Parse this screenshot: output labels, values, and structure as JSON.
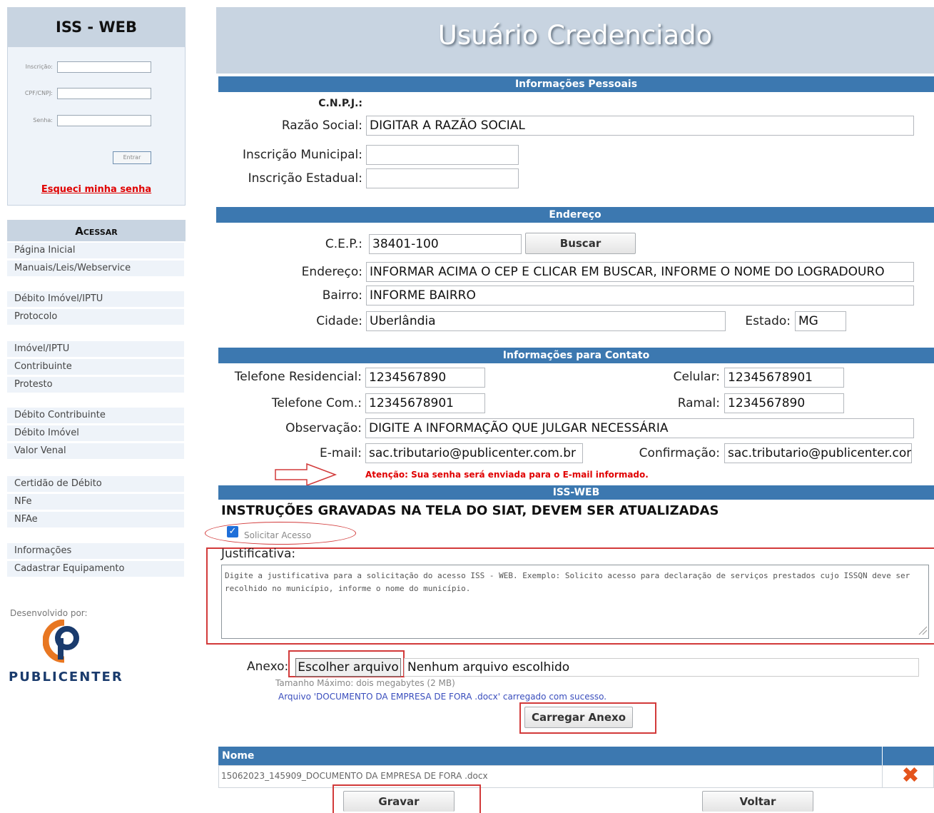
{
  "sidebar": {
    "title": "ISS - WEB",
    "login": {
      "inscricao_label": "Inscrição:",
      "cpf_label": "CPF/CNPJ:",
      "senha_label": "Senha:",
      "enter_label": "Entrar",
      "forgot_label": "Esqueci minha senha"
    },
    "menu_title": "Acessar",
    "menu_items": [
      "Página Inicial",
      "Manuais/Leis/Webservice",
      "Débito Imóvel/IPTU",
      "Protocolo",
      "Imóvel/IPTU",
      "Contribuinte",
      "Protesto",
      "Débito Contribuinte",
      "Débito Imóvel",
      "Valor Venal",
      "Certidão de Débito",
      "NFe",
      "NFAe",
      "Informações",
      "Cadastrar Equipamento"
    ],
    "developed_by": "Desenvolvido por:",
    "logo_text": "PUBLICENTER"
  },
  "main": {
    "title": "Usuário Credenciado",
    "sections": {
      "personal": "Informações Pessoais",
      "address": "Endereço",
      "contact": "Informações para Contato",
      "iss": "ISS-WEB"
    },
    "personal": {
      "cnpj_label": "C.N.P.J.:",
      "razao_label": "Razão Social:",
      "razao_value": "DIGITAR A RAZÃO SOCIAL",
      "insc_mun_label": "Inscrição Municipal:",
      "insc_mun_value": "",
      "insc_est_label": "Inscrição Estadual:",
      "insc_est_value": ""
    },
    "address": {
      "cep_label": "C.E.P.:",
      "cep_value": "38401-100",
      "buscar_label": "Buscar",
      "endereco_label": "Endereço:",
      "endereco_value": "INFORMAR ACIMA O CEP E CLICAR EM BUSCAR, INFORME O NOME DO LOGRADOURO",
      "bairro_label": "Bairro:",
      "bairro_value": "INFORME BAIRRO",
      "cidade_label": "Cidade:",
      "cidade_value": "Uberlândia",
      "estado_label": "Estado:",
      "estado_value": "MG"
    },
    "contact": {
      "tel_res_label": "Telefone Residencial:",
      "tel_res_value": "1234567890",
      "celular_label": "Celular:",
      "celular_value": "12345678901",
      "tel_com_label": "Telefone Com.:",
      "tel_com_value": "12345678901",
      "ramal_label": "Ramal:",
      "ramal_value": "1234567890",
      "obs_label": "Observação:",
      "obs_value": "DIGITE A INFORMAÇÃO QUE JULGAR NECESSÁRIA",
      "email_label": "E-mail:",
      "email_value": "sac.tributario@publicenter.com.br",
      "confirm_label": "Confirmação:",
      "confirm_value": "sac.tributario@publicenter.com.br",
      "warning": "Atenção: Sua senha será enviada para o E-mail informado."
    },
    "iss": {
      "instructions": "INSTRUÇÕES GRAVADAS NA TELA DO SIAT, DEVEM SER ATUALIZADAS",
      "solicitar_label": "Solicitar Acesso",
      "justificativa_label": "Justificativa:",
      "justificativa_value": "Digite a justificativa para a solicitação do acesso ISS - WEB. Exemplo: Solicito acesso para declaração de serviços prestados cujo ISSQN deve ser recolhido no município, informe o nome do município.",
      "anexo_label": "Anexo:",
      "file_button": "Escolher arquivo",
      "file_none": "Nenhum arquivo escolhido",
      "max_size": "Tamanho Máximo: dois megabytes (2 MB)",
      "upload_success": "Arquivo 'DOCUMENTO DA EMPRESA DE FORA .docx' carregado com sucesso.",
      "carregar_label": "Carregar Anexo"
    },
    "table": {
      "header_nome": "Nome",
      "rows": [
        "15062023_145909_DOCUMENTO DA EMPRESA DE FORA .docx"
      ]
    },
    "buttons": {
      "gravar": "Gravar",
      "voltar": "Voltar"
    }
  }
}
